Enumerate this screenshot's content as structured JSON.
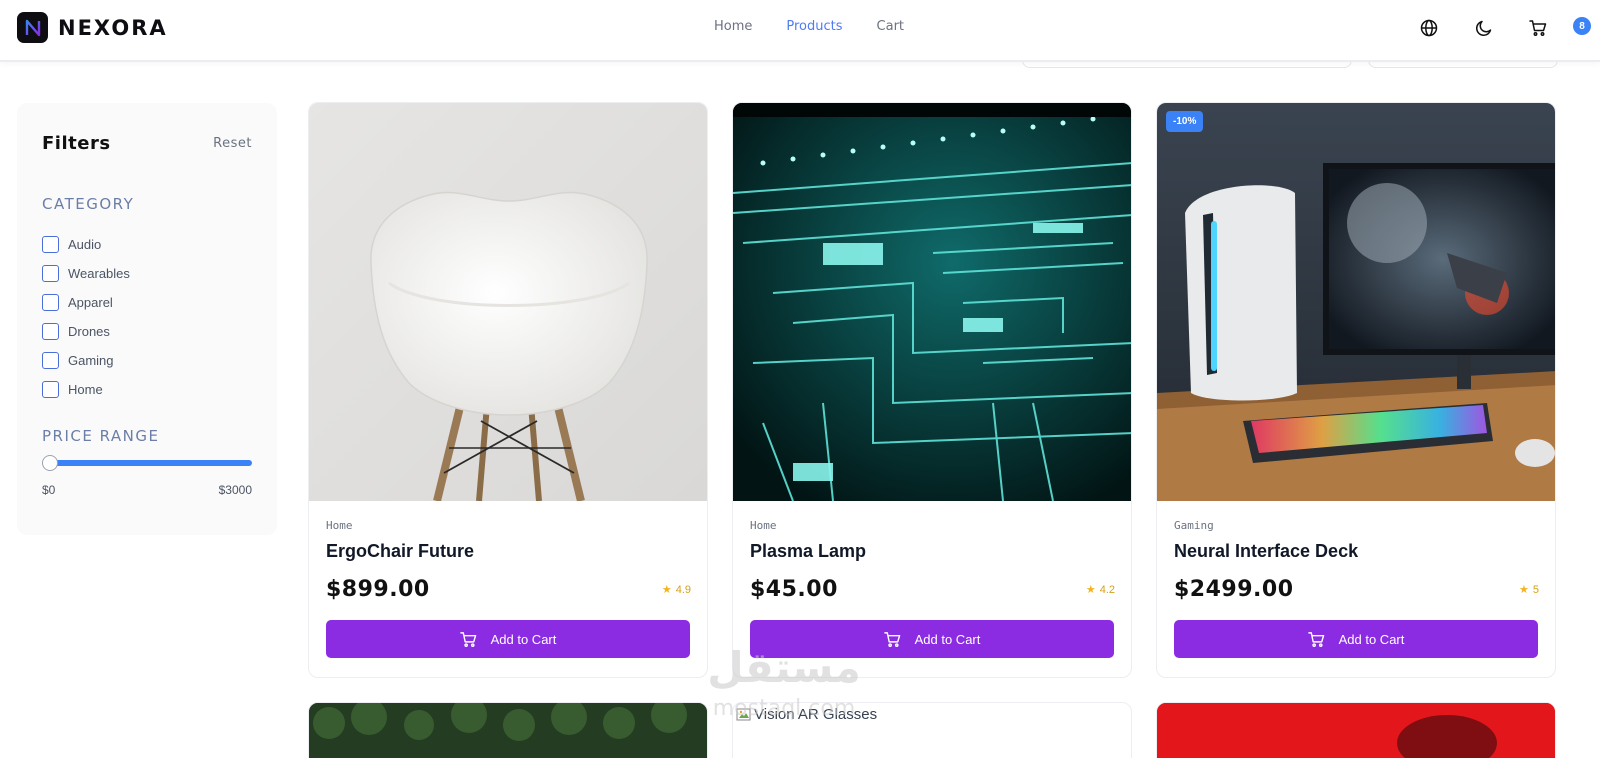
{
  "header": {
    "brand": "NEXORA",
    "nav": [
      {
        "label": "Home",
        "active": false
      },
      {
        "label": "Products",
        "active": true
      },
      {
        "label": "Cart",
        "active": false
      }
    ],
    "icons": [
      "globe-icon",
      "moon-icon",
      "cart-icon"
    ],
    "cart_count": "8"
  },
  "filters": {
    "title": "Filters",
    "reset_label": "Reset",
    "category_title": "CATEGORY",
    "categories": [
      "Audio",
      "Wearables",
      "Apparel",
      "Drones",
      "Gaming",
      "Home"
    ],
    "price_title": "PRICE RANGE",
    "price_min": "$0",
    "price_max": "$3000",
    "slider_value_fraction": 0
  },
  "products": [
    {
      "category": "Home",
      "name": "ErgoChair Future",
      "price": "$899.00",
      "rating": "4.9",
      "discount": "",
      "button": "Add to Cart",
      "image": "white-chair"
    },
    {
      "category": "Home",
      "name": "Plasma Lamp",
      "price": "$45.00",
      "rating": "4.2",
      "discount": "",
      "button": "Add to Cart",
      "image": "circuit-board"
    },
    {
      "category": "Gaming",
      "name": "Neural Interface Deck",
      "price": "$2499.00",
      "rating": "5",
      "discount": "-10%",
      "button": "Add to Cart",
      "image": "gaming-pc"
    }
  ],
  "row2": {
    "broken_image_alt": "Vision AR Glasses"
  },
  "watermark": {
    "arabic": "مستقل",
    "latin": "mostaql.com"
  },
  "colors": {
    "accent_blue": "#3b82f6",
    "button_purple": "#8b2be2",
    "rating_gold": "#f2b31c"
  }
}
